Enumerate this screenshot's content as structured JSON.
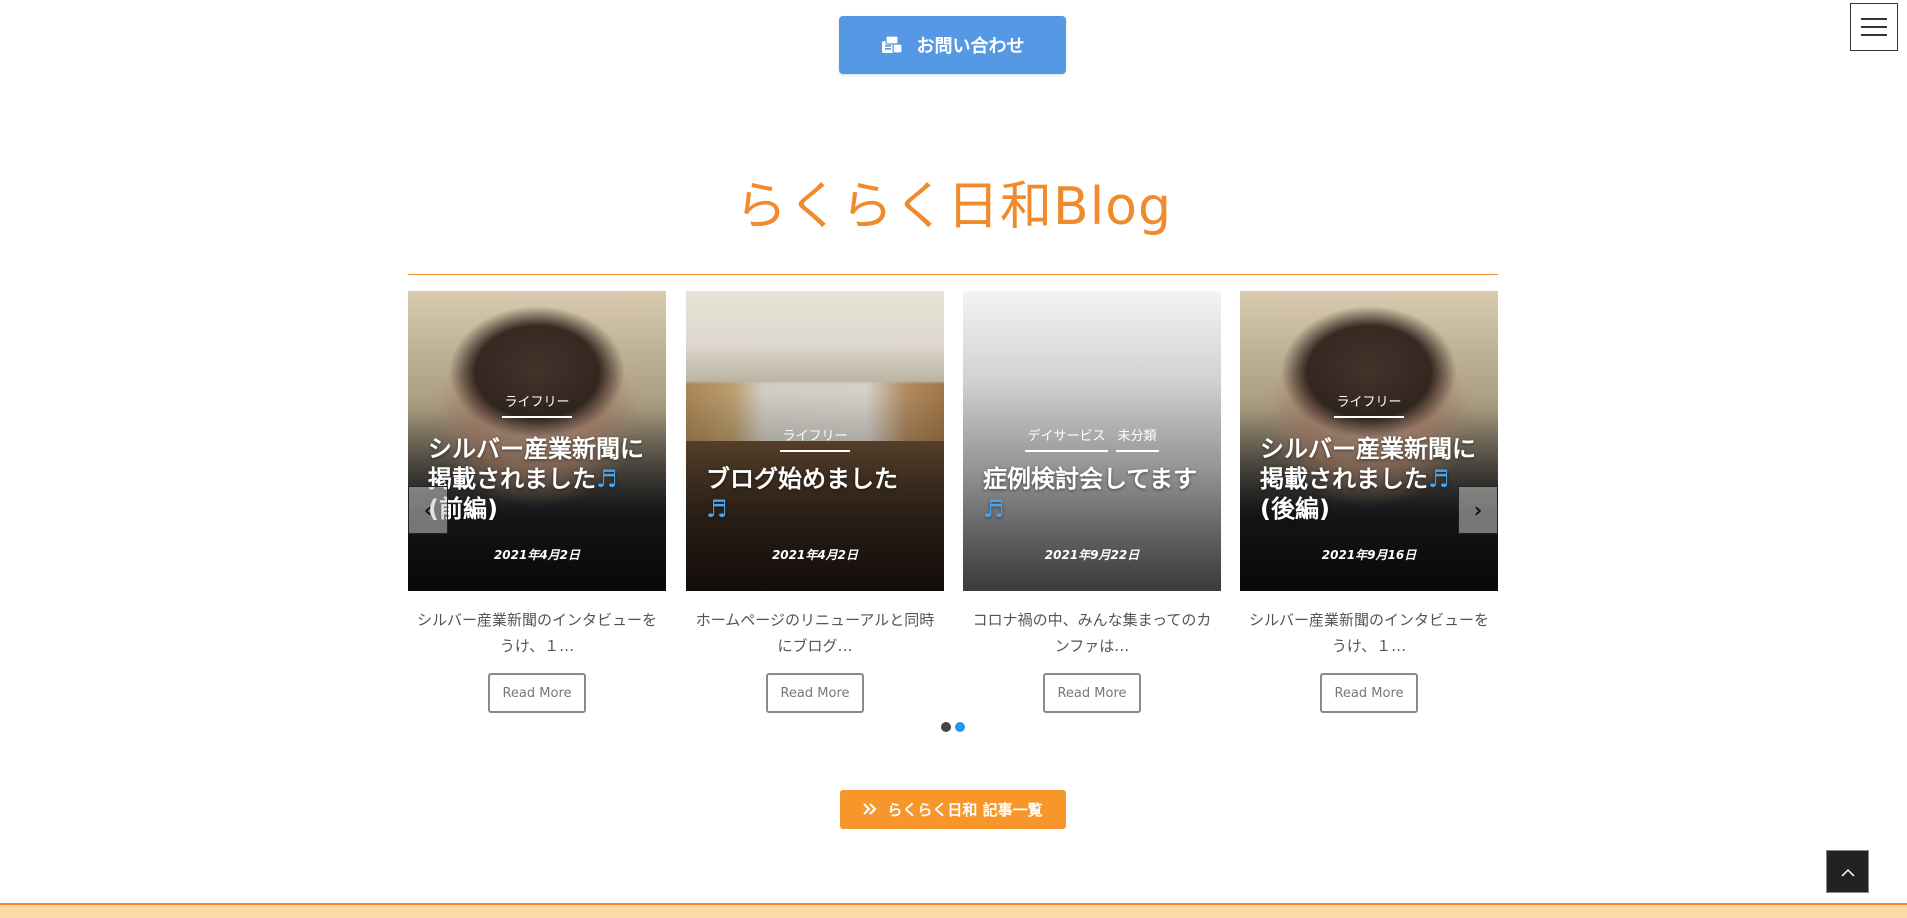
{
  "header": {
    "contact_label": "お問い合わせ",
    "contact_icon": "contact-card-icon",
    "menu_icon": "hamburger-icon"
  },
  "section": {
    "title": "らくらく日和Blog"
  },
  "posts": [
    {
      "categories": [
        "ライフリー"
      ],
      "title": "シルバー産業新聞に掲載されました",
      "title_suffix": "♬",
      "title_tail": "(前編)",
      "date": "2021年4月2日",
      "excerpt_line1": "シルバー産業新聞のインタビューを",
      "excerpt_line2": "うけ、１…",
      "read_more": "Read More"
    },
    {
      "categories": [
        "ライフリー"
      ],
      "title": "ブログ始めました",
      "title_suffix": "♬",
      "title_tail": "",
      "date": "2021年4月2日",
      "excerpt_line1": "ホームページのリニューアルと同時",
      "excerpt_line2": "にブログ…",
      "read_more": "Read More"
    },
    {
      "categories": [
        "デイサービス",
        "未分類"
      ],
      "title": "症例検討会してます",
      "title_suffix": "♬",
      "title_tail": "",
      "date": "2021年9月22日",
      "excerpt_line1": "コロナ禍の中、みんな集まってのカ",
      "excerpt_line2": "ンファは…",
      "read_more": "Read More"
    },
    {
      "categories": [
        "ライフリー"
      ],
      "title": "シルバー産業新聞に掲載されました",
      "title_suffix": "♬",
      "title_tail": "(後編)",
      "date": "2021年9月16日",
      "excerpt_line1": "シルバー産業新聞のインタビューを",
      "excerpt_line2": "うけ、１…",
      "read_more": "Read More"
    }
  ],
  "carousel": {
    "prev_symbol": "‹",
    "next_symbol": "›",
    "page_count": 2,
    "active_page": 2
  },
  "list_button": {
    "label": "らくらく日和 記事一覧",
    "icon": "double-chevron-right-icon"
  },
  "page_top_icon": "chevron-up-icon",
  "colors": {
    "accent_orange": "#f08a2c",
    "contact_blue": "#5598e3",
    "dot_active": "#1e9be8"
  }
}
